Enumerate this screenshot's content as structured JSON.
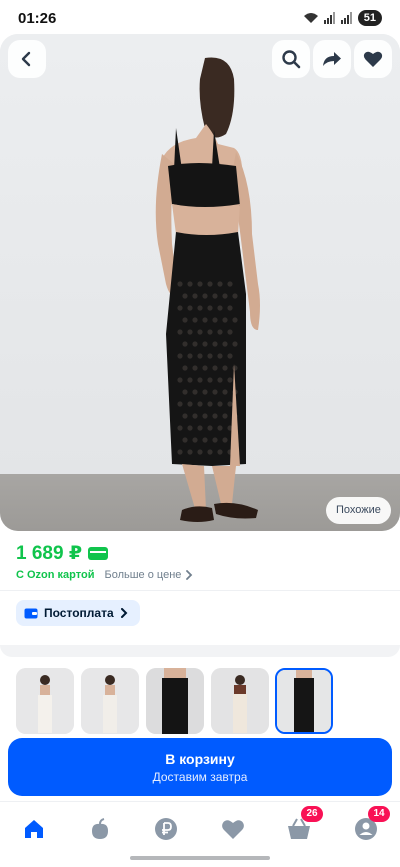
{
  "status_bar": {
    "time": "01:26",
    "battery": "51",
    "icons": [
      "wifi-icon",
      "signal-icon",
      "signal-icon",
      "battery-icon"
    ]
  },
  "hero": {
    "image": "product-photo-model-black-crochet-skirt",
    "back_icon": "chevron-left-icon",
    "search_icon": "search-icon",
    "share_icon": "share-arrow-icon",
    "favorite_icon": "heart-icon",
    "similar_label": "Похожие"
  },
  "price": {
    "value": "1 689 ₽",
    "card_icon": "card-icon",
    "ozon_card_label": "С Ozon картой",
    "more_label": "Больше о цене"
  },
  "postpay": {
    "label": "Постоплата",
    "icon": "wallet-icon"
  },
  "thumbnails": [
    {
      "name": "thumb-1",
      "tone": "white"
    },
    {
      "name": "thumb-2",
      "tone": "white"
    },
    {
      "name": "thumb-3",
      "tone": "black"
    },
    {
      "name": "thumb-4",
      "tone": "brown"
    },
    {
      "name": "thumb-5",
      "tone": "black",
      "selected": true
    }
  ],
  "cart": {
    "main_label": "В корзину",
    "sub_label": "Доставим завтра"
  },
  "nav": {
    "items": [
      {
        "icon": "home-icon",
        "active": true
      },
      {
        "icon": "fruit-icon"
      },
      {
        "icon": "ruble-icon"
      },
      {
        "icon": "heart-icon"
      },
      {
        "icon": "cart-icon",
        "badge": "26"
      },
      {
        "icon": "profile-icon",
        "badge": "14"
      }
    ]
  },
  "colors": {
    "accent_blue": "#005bff",
    "price_green": "#10c44c",
    "badge_pink": "#f91155",
    "text_dark": "#001a34"
  }
}
